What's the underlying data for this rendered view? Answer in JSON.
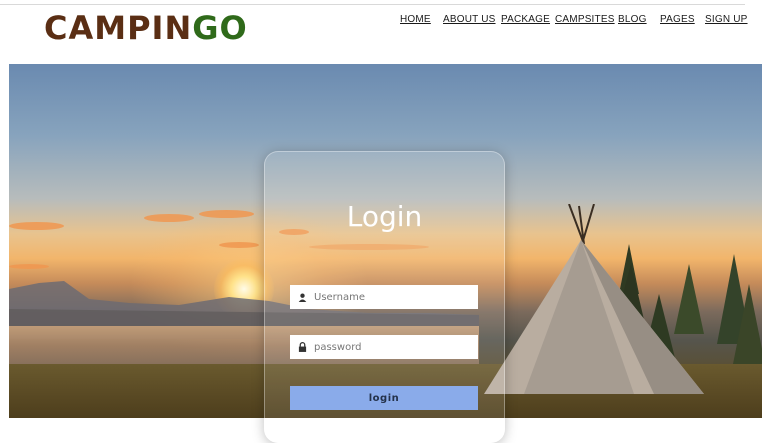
{
  "brand": {
    "part1": "CAMPIN",
    "part2": "GO"
  },
  "nav": {
    "items": [
      {
        "label": "HOME"
      },
      {
        "label": "ABOUT US"
      },
      {
        "label": "PACKAGE"
      },
      {
        "label": "CAMPSITES"
      },
      {
        "label": "BLOG"
      },
      {
        "label": "PAGES"
      },
      {
        "label": "SIGN UP"
      }
    ]
  },
  "login": {
    "title": "Login",
    "username_placeholder": "Username",
    "password_placeholder": "password",
    "button_label": "login"
  },
  "colors": {
    "brand_brown": "#5a2e14",
    "brand_green": "#2f6a1a",
    "button_blue": "#8aabea"
  },
  "icons": {
    "username": "user-icon",
    "password": "lock-icon"
  }
}
